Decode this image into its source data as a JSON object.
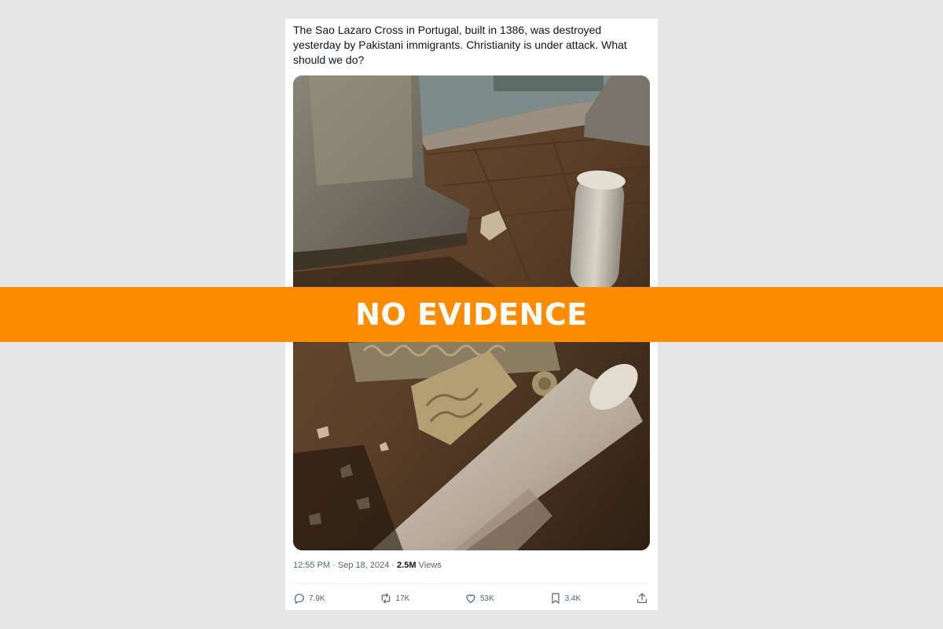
{
  "tweet": {
    "text": "The Sao Lazaro Cross in Portugal, built in 1386, was destroyed yesterday by Pakistani immigrants. Christianity is under attack. What should we do?",
    "timestamp": "12:55 PM · Sep 18, 2024 · ",
    "views_count": "2.5M",
    "views_label": " Views",
    "actions": {
      "replies": "7.9K",
      "reposts": "17K",
      "likes": "53K",
      "bookmarks": "3.4K"
    }
  },
  "verdict": {
    "label": "NO EVIDENCE",
    "color": "#ff8c00"
  },
  "icons": {
    "reply": "speech-bubble",
    "repost": "repost-arrows",
    "like": "heart",
    "bookmark": "bookmark",
    "share": "upload-arrow"
  }
}
